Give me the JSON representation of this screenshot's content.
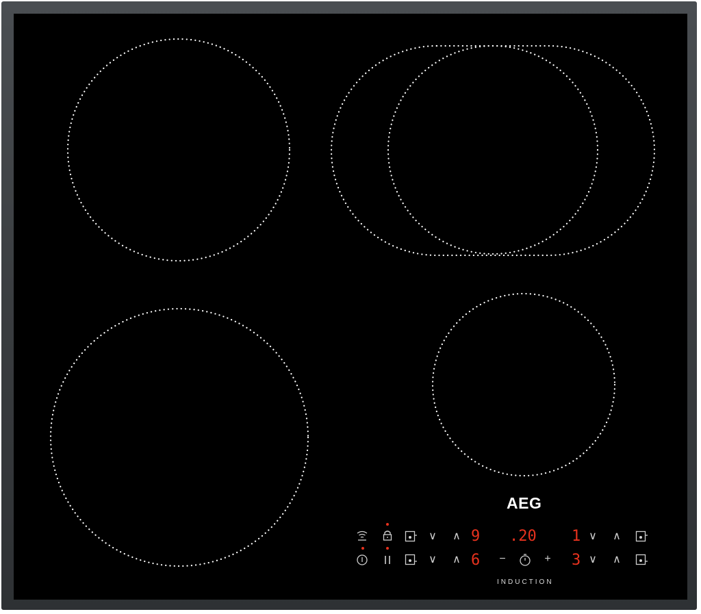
{
  "brand": {
    "logo_text": "AEG",
    "caption": "INDUCTION"
  },
  "colors": {
    "glass": "#000000",
    "frame": "#3d4044",
    "zone_dots": "#ffffff",
    "display": "#e8321e"
  },
  "controls": {
    "row1": {
      "left_down": "∨",
      "left_up": "∧",
      "left_level": "9",
      "timer": ".20",
      "right_level": "1",
      "right_down": "∨",
      "right_up": "∧"
    },
    "row2": {
      "left_down": "∨",
      "left_up": "∧",
      "left_level": "6",
      "timer_minus": "−",
      "timer_plus": "+",
      "right_level": "3",
      "right_down": "∨",
      "right_up": "∧"
    },
    "icons": [
      "wifi-icon",
      "child-lock-icon",
      "zone-select-icon",
      "power-icon",
      "pause-icon",
      "timer-clock-icon"
    ]
  }
}
